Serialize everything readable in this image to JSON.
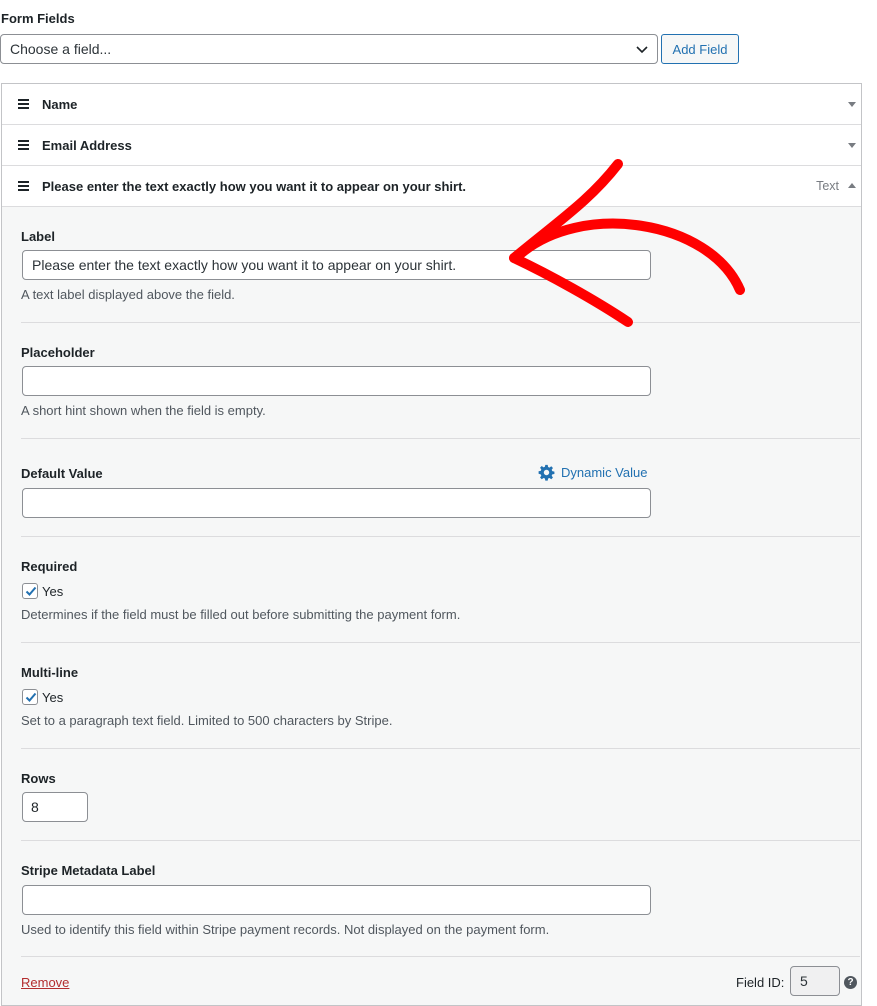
{
  "header": {
    "title": "Form Fields"
  },
  "picker": {
    "placeholder": "Choose a field...",
    "add_label": "Add Field"
  },
  "fields": [
    {
      "title": "Name",
      "type": ""
    },
    {
      "title": "Email Address",
      "type": ""
    },
    {
      "title": "Please enter the text exactly how you want it to appear on your shirt.",
      "type": "Text"
    }
  ],
  "panel": {
    "label": {
      "title": "Label",
      "value": "Please enter the text exactly how you want it to appear on your shirt.",
      "desc": "A text label displayed above the field."
    },
    "placeholder": {
      "title": "Placeholder",
      "value": "",
      "desc": "A short hint shown when the field is empty."
    },
    "default_value": {
      "title": "Default Value",
      "value": "",
      "dynamic_label": "Dynamic Value"
    },
    "required": {
      "title": "Required",
      "checked": true,
      "option": "Yes",
      "desc": "Determines if the field must be filled out before submitting the payment form."
    },
    "multiline": {
      "title": "Multi-line",
      "checked": true,
      "option": "Yes",
      "desc": "Set to a paragraph text field. Limited to 500 characters by Stripe."
    },
    "rows": {
      "title": "Rows",
      "value": "8"
    },
    "metadata": {
      "title": "Stripe Metadata Label",
      "value": "",
      "desc": "Used to identify this field within Stripe payment records. Not displayed on the payment form."
    },
    "footer": {
      "remove_label": "Remove",
      "field_id_label": "Field ID:",
      "field_id": "5",
      "help_glyph": "?"
    }
  },
  "colors": {
    "accent": "#2271b1",
    "danger": "#b32d2e",
    "annotation": "#ff0000"
  }
}
